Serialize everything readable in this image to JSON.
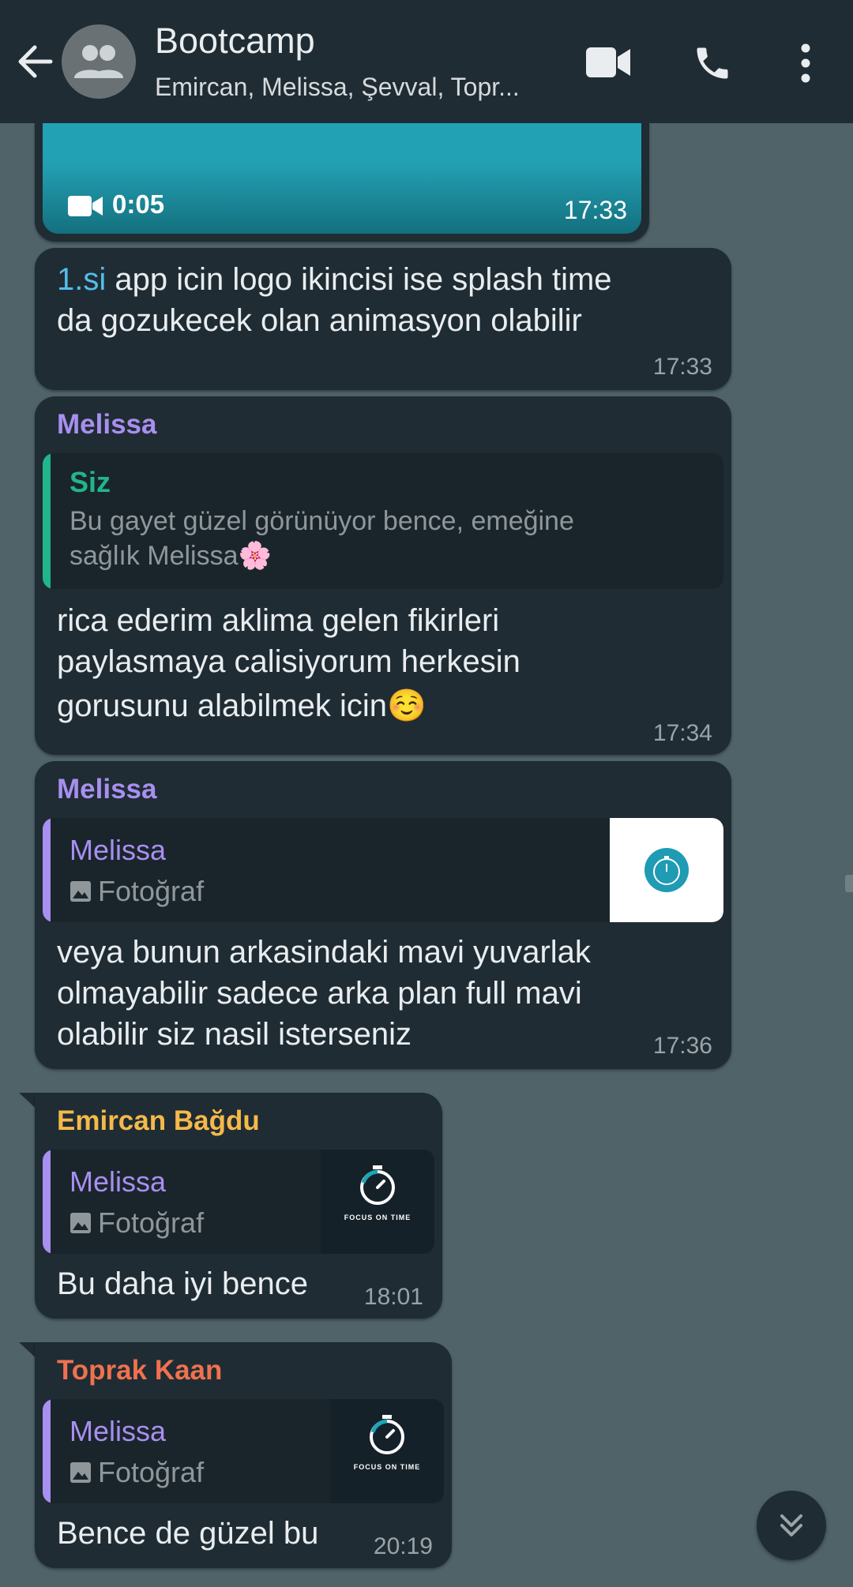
{
  "header": {
    "title": "Bootcamp",
    "subtitle": "Emircan, Melissa, Şevval, Topr..."
  },
  "messages": {
    "video": {
      "duration": "0:05",
      "time": "17:33"
    },
    "m1": {
      "highlight": "1.si",
      "line1_rest": " app icin logo ikincisi ise splash time",
      "line2": "da gozukecek olan animasyon olabilir",
      "time": "17:33"
    },
    "m2": {
      "sender": "Melissa",
      "quote_name": "Siz",
      "quote_line1": "Bu gayet güzel görünüyor bence, emeğine",
      "quote_line2": "sağlık Melissa🌸",
      "line1": "rica ederim aklima gelen fikirleri",
      "line2": "paylasmaya calisiyorum herkesin",
      "line3": "gorusunu alabilmek icin☺️",
      "time": "17:34"
    },
    "m3": {
      "sender": "Melissa",
      "quote_name": "Melissa",
      "quote_photo": "Fotoğraf",
      "line1": "veya bunun arkasindaki mavi yuvarlak",
      "line2": "olmayabilir sadece arka plan full mavi",
      "line3": "olabilir siz nasil isterseniz",
      "time": "17:36"
    },
    "m4": {
      "sender": "Emircan Bağdu",
      "quote_name": "Melissa",
      "quote_photo": "Fotoğraf",
      "thumb_label": "FOCUS ON TIME",
      "line1": "Bu daha iyi bence",
      "time": "18:01"
    },
    "m5": {
      "sender": "Toprak Kaan",
      "quote_name": "Melissa",
      "quote_photo": "Fotoğraf",
      "thumb_label": "FOCUS ON TIME",
      "line1": "Bence de güzel bu",
      "time": "20:19"
    }
  },
  "colors": {
    "melissa": "#a88ff0",
    "siz": "#21b58a",
    "emircan": "#f5b94a",
    "toprak": "#f0714f",
    "link": "#53bdeb"
  }
}
